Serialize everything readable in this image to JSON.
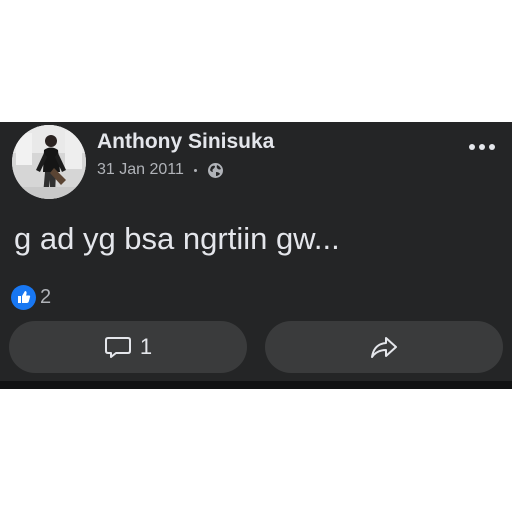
{
  "post": {
    "author": "Anthony Sinisuka",
    "date": "31 Jan 2011",
    "separator": "·",
    "privacy_icon": "globe-icon",
    "text": "g ad yg bsa ngrtiin gw...",
    "reaction_icon": "like-icon",
    "reaction_count": "2",
    "comment_count": "1",
    "share_icon": "share-arrow-icon",
    "menu_icon": "more-dots-icon"
  },
  "colors": {
    "post_background": "#242526",
    "button_background": "#3a3b3c",
    "primary_text": "#e4e6eb",
    "secondary_text": "#b0b3b8",
    "like_blue": "#1877f2"
  }
}
